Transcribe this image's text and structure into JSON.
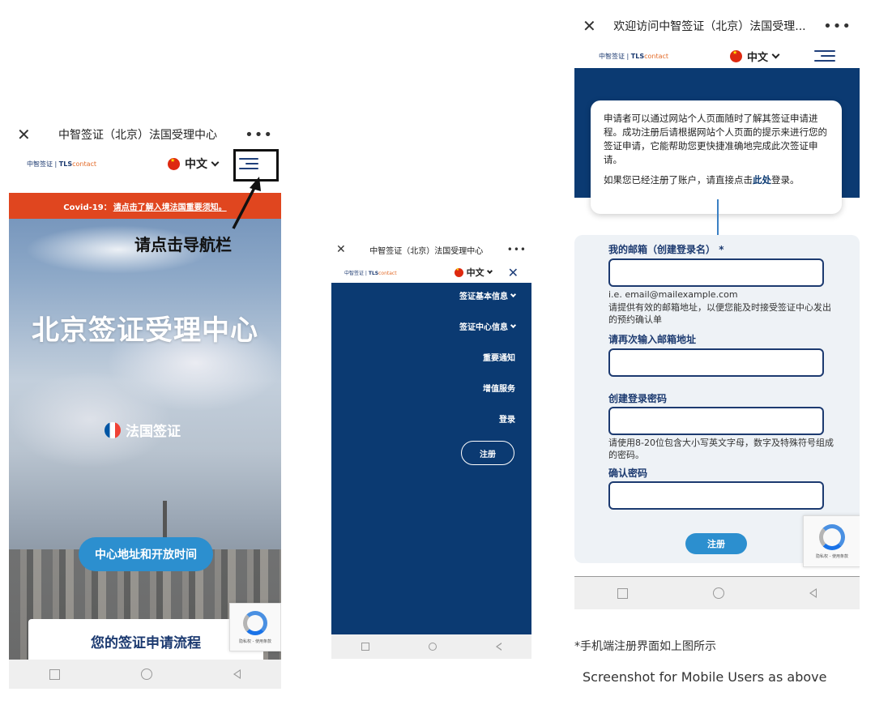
{
  "screen1": {
    "title": "中智签证（北京）法国受理中心",
    "brand": {
      "prefix": "中智签证",
      "tls": "TLS",
      "contact": "contact"
    },
    "language": "中文",
    "covid": {
      "prefix": "Covid-19：",
      "link": "请点击了解入境法国重要须知。"
    },
    "nav_hint": "请点击导航栏",
    "hero_title": "北京签证受理中心",
    "hero_subtitle": "法国签证",
    "cta_label": "中心地址和开放时间",
    "process_title": "您的签证申请流程",
    "recaptcha_text": "隐私权 - 使用条款"
  },
  "screen2": {
    "title": "中智签证（北京）法国受理中心",
    "brand": {
      "prefix": "中智签证",
      "tls": "TLS",
      "contact": "contact"
    },
    "language": "中文",
    "menu": {
      "basic_info": "签证基本信息",
      "center_info": "签证中心信息",
      "notice": "重要通知",
      "value_added": "增值服务",
      "login": "登录",
      "register": "注册"
    }
  },
  "screen3": {
    "title": "欢迎访问中智签证（北京）法国受理...",
    "brand": {
      "prefix": "中智签证",
      "tls": "TLS",
      "contact": "contact"
    },
    "language": "中文",
    "tooltip": {
      "para1": "申请者可以通过网站个人页面随时了解其签证申请进程。成功注册后请根据网站个人页面的提示来进行您的签证申请，它能帮助您更快捷准确地完成此次签证申请。",
      "para2_prefix": "如果您已经注册了账户，请直接点击",
      "para2_link": "此处",
      "para2_suffix": "登录。"
    },
    "form": {
      "email_label": "我的邮箱（创建登录名）",
      "required_mark": "*",
      "email_example": "i.e. email@mailexample.com",
      "email_help": "请提供有效的邮箱地址，以便您能及时接受签证中心发出的预约确认单",
      "email_confirm_label": "请再次输入邮箱地址",
      "password_label": "创建登录密码",
      "password_help": "请使用8-20位包含大小写英文字母，数字及特殊符号组成的密码。",
      "password_confirm_label": "确认密码",
      "submit_label": "注册"
    },
    "recaptcha_text": "隐私权 - 使用条款"
  },
  "captions": {
    "cn": "*手机端注册界面如上图所示",
    "en": "Screenshot for Mobile Users as above"
  },
  "colors": {
    "navy": "#0b3a72",
    "accent_blue": "#2c8fcf",
    "covid_red": "#e0461f"
  }
}
